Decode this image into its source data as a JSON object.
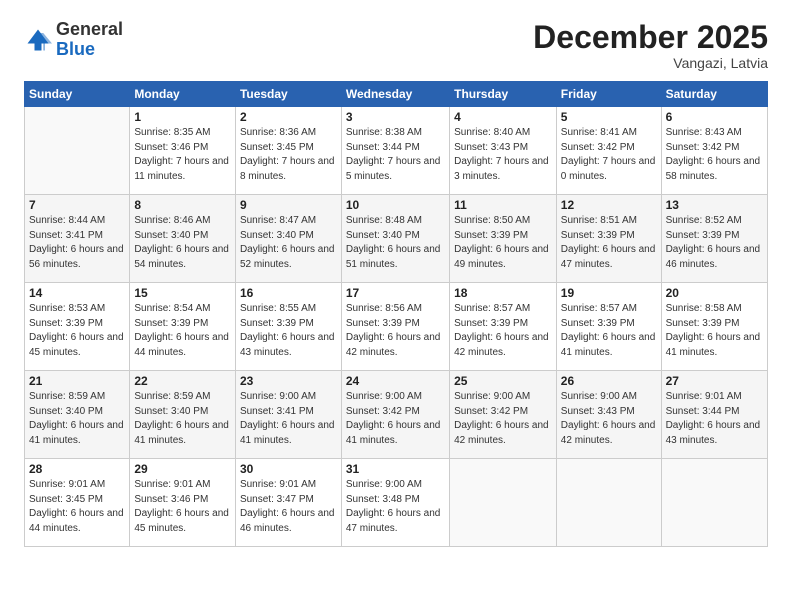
{
  "logo": {
    "general": "General",
    "blue": "Blue"
  },
  "header": {
    "month": "December 2025",
    "location": "Vangazi, Latvia"
  },
  "weekdays": [
    "Sunday",
    "Monday",
    "Tuesday",
    "Wednesday",
    "Thursday",
    "Friday",
    "Saturday"
  ],
  "weeks": [
    [
      {
        "num": "",
        "sunrise": "",
        "sunset": "",
        "daylight": ""
      },
      {
        "num": "1",
        "sunrise": "Sunrise: 8:35 AM",
        "sunset": "Sunset: 3:46 PM",
        "daylight": "Daylight: 7 hours and 11 minutes."
      },
      {
        "num": "2",
        "sunrise": "Sunrise: 8:36 AM",
        "sunset": "Sunset: 3:45 PM",
        "daylight": "Daylight: 7 hours and 8 minutes."
      },
      {
        "num": "3",
        "sunrise": "Sunrise: 8:38 AM",
        "sunset": "Sunset: 3:44 PM",
        "daylight": "Daylight: 7 hours and 5 minutes."
      },
      {
        "num": "4",
        "sunrise": "Sunrise: 8:40 AM",
        "sunset": "Sunset: 3:43 PM",
        "daylight": "Daylight: 7 hours and 3 minutes."
      },
      {
        "num": "5",
        "sunrise": "Sunrise: 8:41 AM",
        "sunset": "Sunset: 3:42 PM",
        "daylight": "Daylight: 7 hours and 0 minutes."
      },
      {
        "num": "6",
        "sunrise": "Sunrise: 8:43 AM",
        "sunset": "Sunset: 3:42 PM",
        "daylight": "Daylight: 6 hours and 58 minutes."
      }
    ],
    [
      {
        "num": "7",
        "sunrise": "Sunrise: 8:44 AM",
        "sunset": "Sunset: 3:41 PM",
        "daylight": "Daylight: 6 hours and 56 minutes."
      },
      {
        "num": "8",
        "sunrise": "Sunrise: 8:46 AM",
        "sunset": "Sunset: 3:40 PM",
        "daylight": "Daylight: 6 hours and 54 minutes."
      },
      {
        "num": "9",
        "sunrise": "Sunrise: 8:47 AM",
        "sunset": "Sunset: 3:40 PM",
        "daylight": "Daylight: 6 hours and 52 minutes."
      },
      {
        "num": "10",
        "sunrise": "Sunrise: 8:48 AM",
        "sunset": "Sunset: 3:40 PM",
        "daylight": "Daylight: 6 hours and 51 minutes."
      },
      {
        "num": "11",
        "sunrise": "Sunrise: 8:50 AM",
        "sunset": "Sunset: 3:39 PM",
        "daylight": "Daylight: 6 hours and 49 minutes."
      },
      {
        "num": "12",
        "sunrise": "Sunrise: 8:51 AM",
        "sunset": "Sunset: 3:39 PM",
        "daylight": "Daylight: 6 hours and 47 minutes."
      },
      {
        "num": "13",
        "sunrise": "Sunrise: 8:52 AM",
        "sunset": "Sunset: 3:39 PM",
        "daylight": "Daylight: 6 hours and 46 minutes."
      }
    ],
    [
      {
        "num": "14",
        "sunrise": "Sunrise: 8:53 AM",
        "sunset": "Sunset: 3:39 PM",
        "daylight": "Daylight: 6 hours and 45 minutes."
      },
      {
        "num": "15",
        "sunrise": "Sunrise: 8:54 AM",
        "sunset": "Sunset: 3:39 PM",
        "daylight": "Daylight: 6 hours and 44 minutes."
      },
      {
        "num": "16",
        "sunrise": "Sunrise: 8:55 AM",
        "sunset": "Sunset: 3:39 PM",
        "daylight": "Daylight: 6 hours and 43 minutes."
      },
      {
        "num": "17",
        "sunrise": "Sunrise: 8:56 AM",
        "sunset": "Sunset: 3:39 PM",
        "daylight": "Daylight: 6 hours and 42 minutes."
      },
      {
        "num": "18",
        "sunrise": "Sunrise: 8:57 AM",
        "sunset": "Sunset: 3:39 PM",
        "daylight": "Daylight: 6 hours and 42 minutes."
      },
      {
        "num": "19",
        "sunrise": "Sunrise: 8:57 AM",
        "sunset": "Sunset: 3:39 PM",
        "daylight": "Daylight: 6 hours and 41 minutes."
      },
      {
        "num": "20",
        "sunrise": "Sunrise: 8:58 AM",
        "sunset": "Sunset: 3:39 PM",
        "daylight": "Daylight: 6 hours and 41 minutes."
      }
    ],
    [
      {
        "num": "21",
        "sunrise": "Sunrise: 8:59 AM",
        "sunset": "Sunset: 3:40 PM",
        "daylight": "Daylight: 6 hours and 41 minutes."
      },
      {
        "num": "22",
        "sunrise": "Sunrise: 8:59 AM",
        "sunset": "Sunset: 3:40 PM",
        "daylight": "Daylight: 6 hours and 41 minutes."
      },
      {
        "num": "23",
        "sunrise": "Sunrise: 9:00 AM",
        "sunset": "Sunset: 3:41 PM",
        "daylight": "Daylight: 6 hours and 41 minutes."
      },
      {
        "num": "24",
        "sunrise": "Sunrise: 9:00 AM",
        "sunset": "Sunset: 3:42 PM",
        "daylight": "Daylight: 6 hours and 41 minutes."
      },
      {
        "num": "25",
        "sunrise": "Sunrise: 9:00 AM",
        "sunset": "Sunset: 3:42 PM",
        "daylight": "Daylight: 6 hours and 42 minutes."
      },
      {
        "num": "26",
        "sunrise": "Sunrise: 9:00 AM",
        "sunset": "Sunset: 3:43 PM",
        "daylight": "Daylight: 6 hours and 42 minutes."
      },
      {
        "num": "27",
        "sunrise": "Sunrise: 9:01 AM",
        "sunset": "Sunset: 3:44 PM",
        "daylight": "Daylight: 6 hours and 43 minutes."
      }
    ],
    [
      {
        "num": "28",
        "sunrise": "Sunrise: 9:01 AM",
        "sunset": "Sunset: 3:45 PM",
        "daylight": "Daylight: 6 hours and 44 minutes."
      },
      {
        "num": "29",
        "sunrise": "Sunrise: 9:01 AM",
        "sunset": "Sunset: 3:46 PM",
        "daylight": "Daylight: 6 hours and 45 minutes."
      },
      {
        "num": "30",
        "sunrise": "Sunrise: 9:01 AM",
        "sunset": "Sunset: 3:47 PM",
        "daylight": "Daylight: 6 hours and 46 minutes."
      },
      {
        "num": "31",
        "sunrise": "Sunrise: 9:00 AM",
        "sunset": "Sunset: 3:48 PM",
        "daylight": "Daylight: 6 hours and 47 minutes."
      },
      {
        "num": "",
        "sunrise": "",
        "sunset": "",
        "daylight": ""
      },
      {
        "num": "",
        "sunrise": "",
        "sunset": "",
        "daylight": ""
      },
      {
        "num": "",
        "sunrise": "",
        "sunset": "",
        "daylight": ""
      }
    ]
  ]
}
